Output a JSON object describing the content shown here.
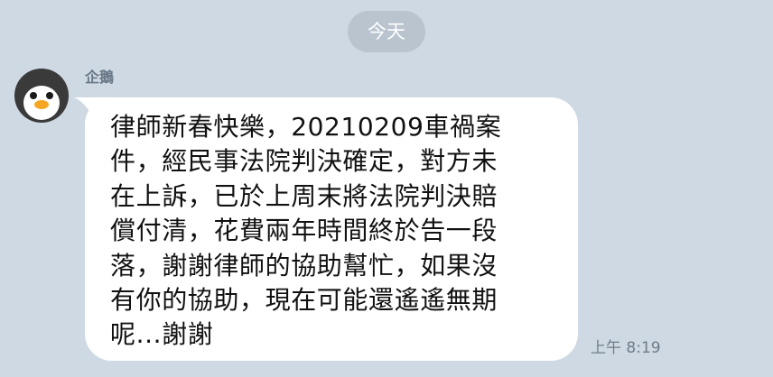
{
  "chat": {
    "date_divider": "今天",
    "message": {
      "sender": "企鵝",
      "avatar_icon": "penguin-avatar-icon",
      "text": "律師新春快樂，20210209車禍案\n件，經民事法院判決確定，對方未\n在上訴，已於上周末將法院判決賠\n償付清，花費兩年時間終於告一段\n落，謝謝律師的協助幫忙，如果沒\n有你的協助，現在可能還遙遙無期\n呢...謝謝",
      "time": "上午 8:19"
    }
  },
  "colors": {
    "background": "#cfd9e3",
    "bubble": "#ffffff",
    "date_pill": "#b9c4cf"
  }
}
